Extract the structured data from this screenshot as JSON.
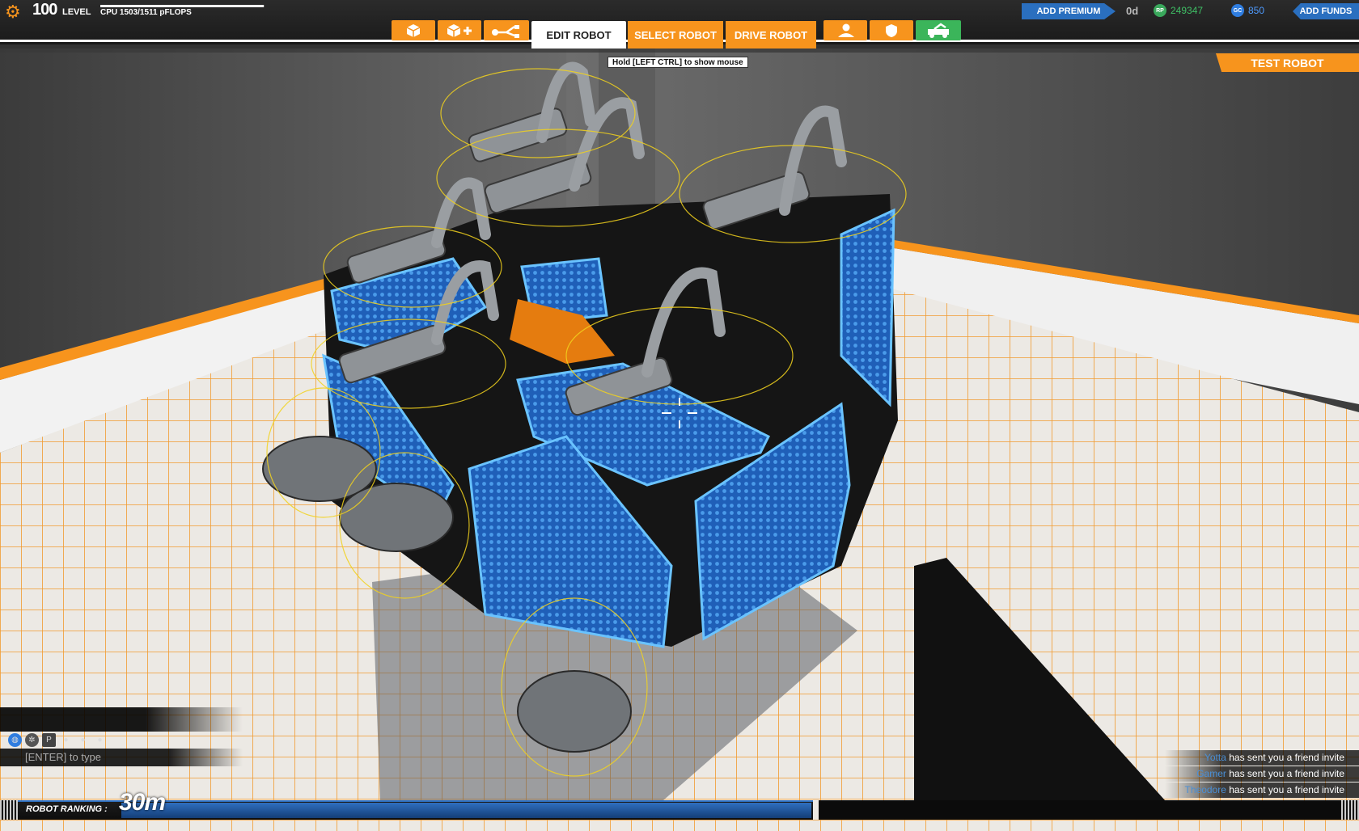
{
  "player": {
    "level_number": "100",
    "level_label": "LEVEL",
    "cpu_text": "CPU 1503/1511 pFLOPS",
    "cpu_fraction": 0.995
  },
  "toolbar": {
    "icons": [
      "cube-icon",
      "cube-add-icon",
      "connect-icon"
    ],
    "tabs": {
      "edit": "EDIT ROBOT",
      "select": "SELECT ROBOT",
      "drive": "DRIVE ROBOT"
    },
    "right_icons": [
      "player-icon",
      "shield-icon",
      "garage-icon"
    ]
  },
  "hint": "Hold [LEFT CTRL] to show mouse",
  "test_robot": "TEST ROBOT",
  "currency": {
    "add_premium": "ADD PREMIUM",
    "premium_days": "0d",
    "rp_icon": "RP",
    "rp_value": "249347",
    "gc_icon": "GC",
    "gc_value": "850",
    "add_funds": "ADD FUNDS"
  },
  "chat": {
    "placeholder": "[ENTER] to type",
    "channel_icons": [
      "globe-icon",
      "group-icon",
      "party-icon",
      "user-icon",
      "user-icon",
      "user-icon"
    ]
  },
  "notifications": [
    {
      "name": "Yotta",
      "text": "has sent you a friend invite"
    },
    {
      "name": "Gamer",
      "text": "has sent you a friend invite"
    },
    {
      "name": "Theodore",
      "text": "has sent you a friend invite"
    }
  ],
  "ranking": {
    "label": "ROBOT RANKING :",
    "value": "30m"
  },
  "colors": {
    "accent": "#f7941d",
    "blue": "#2a6fbf",
    "rp": "#3fbf65",
    "gc": "#4e9bff"
  }
}
